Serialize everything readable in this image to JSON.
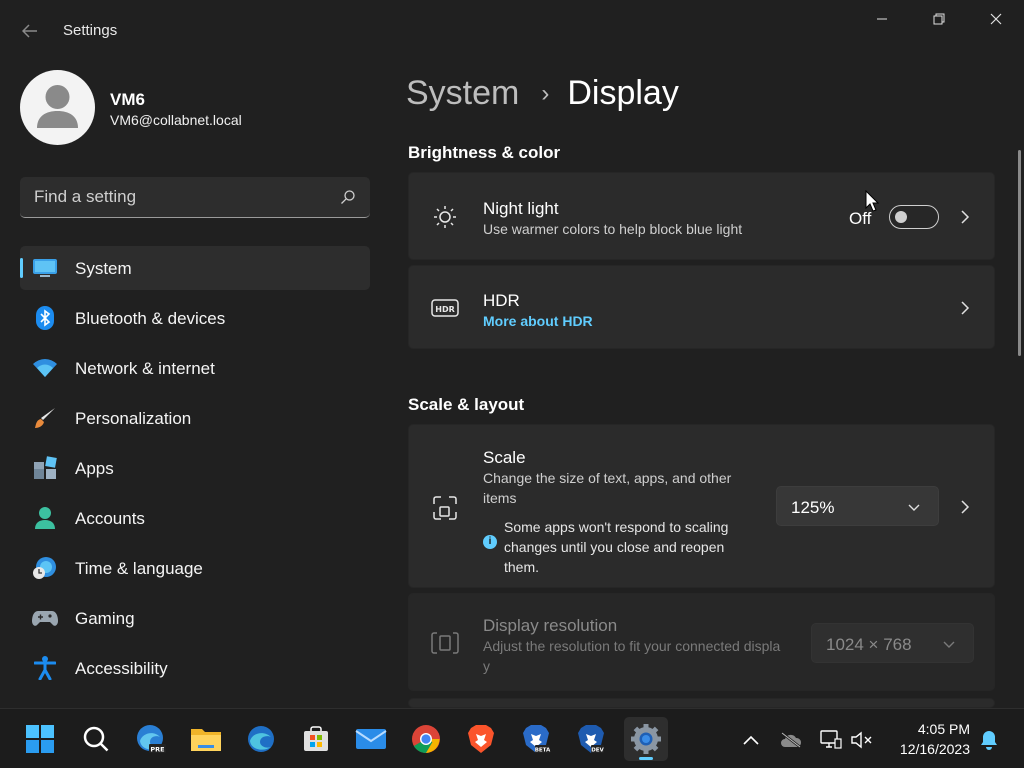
{
  "window": {
    "app_title": "Settings"
  },
  "profile": {
    "name": "VM6",
    "email": "VM6@collabnet.local"
  },
  "search": {
    "placeholder": "Find a setting"
  },
  "nav": {
    "items": [
      {
        "label": "System",
        "icon": "monitor-icon",
        "selected": true
      },
      {
        "label": "Bluetooth & devices",
        "icon": "bluetooth-icon"
      },
      {
        "label": "Network & internet",
        "icon": "wifi-icon"
      },
      {
        "label": "Personalization",
        "icon": "brush-icon"
      },
      {
        "label": "Apps",
        "icon": "apps-icon"
      },
      {
        "label": "Accounts",
        "icon": "accounts-icon"
      },
      {
        "label": "Time & language",
        "icon": "globe-clock-icon"
      },
      {
        "label": "Gaming",
        "icon": "gamepad-icon"
      },
      {
        "label": "Accessibility",
        "icon": "accessibility-icon"
      }
    ]
  },
  "breadcrumb": {
    "parent": "System",
    "separator": "›",
    "current": "Display"
  },
  "sections": {
    "brightness": {
      "heading": "Brightness & color",
      "night_light": {
        "title": "Night light",
        "description": "Use warmer colors to help block blue light",
        "state_label": "Off",
        "enabled": false
      },
      "hdr": {
        "title": "HDR",
        "link": "More about HDR"
      }
    },
    "scale_layout": {
      "heading": "Scale & layout",
      "scale": {
        "title": "Scale",
        "description": "Change the size of text, apps, and other items",
        "value": "125%",
        "note": "Some apps won't respond to scaling changes until you close and reopen them."
      },
      "resolution": {
        "title": "Display resolution",
        "description": "Adjust the resolution to fit your connected display",
        "value": "1024 × 768"
      }
    }
  },
  "taskbar": {
    "apps": [
      "start-icon",
      "search-icon",
      "edge-preview-icon",
      "file-explorer-icon",
      "edge-icon",
      "store-icon",
      "mail-icon",
      "chrome-icon",
      "brave-icon",
      "brave-beta-icon",
      "brave-dev-icon",
      "settings-icon"
    ],
    "time": "4:05 PM",
    "date": "12/16/2023"
  },
  "colors": {
    "accent": "#60cdff",
    "background": "#202020",
    "card": "#2b2b2b"
  }
}
